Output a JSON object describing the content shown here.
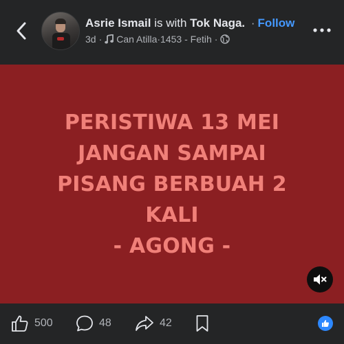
{
  "header": {
    "author": "Asrie Ismail",
    "with_text": "is with",
    "tagged": "Tok Naga.",
    "separator": "·",
    "follow_label": "Follow",
    "time": "3d",
    "music": "Can Atilla·1453 - Fetih",
    "audience_icon": "globe-icon"
  },
  "post": {
    "lines": [
      "PERISTIWA 13 MEI",
      "JANGAN SAMPAI",
      "PISANG BERBUAH 2",
      "KALI",
      "- AGONG -"
    ],
    "background": "#8b1f22",
    "text_color": "#f08079"
  },
  "actions": {
    "likes": "500",
    "comments": "48",
    "shares": "42"
  },
  "colors": {
    "accent": "#4599ff",
    "like_badge": "#2d88ff"
  }
}
